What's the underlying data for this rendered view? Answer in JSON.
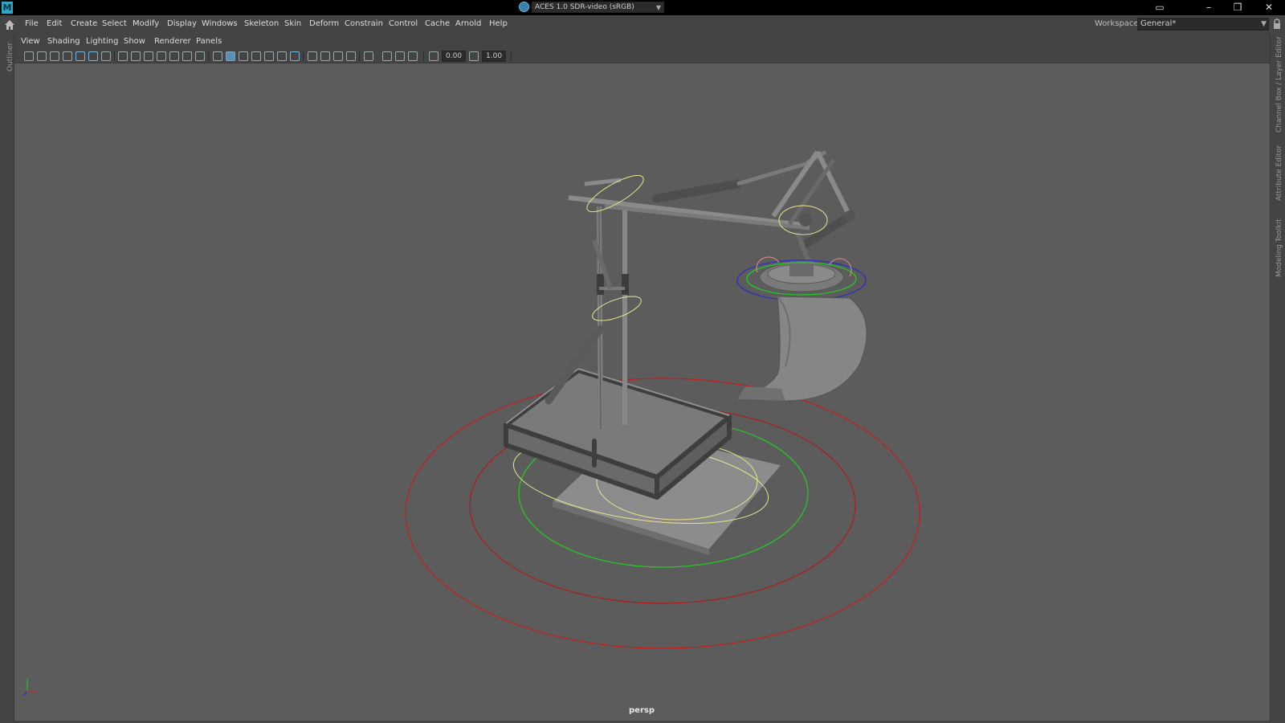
{
  "app": {
    "logo_letter": "M"
  },
  "menubar": {
    "items": [
      "File",
      "Edit",
      "Create",
      "Select",
      "Modify",
      "Display",
      "Windows",
      "Skeleton",
      "Skin",
      "Deform",
      "Constrain",
      "Control",
      "Cache",
      "Arnold",
      "Help"
    ],
    "workspace_label": "Workspace:",
    "workspace_value": "General*"
  },
  "side_tabs": {
    "left": "Outliner",
    "right": [
      "Channel Box / Layer Editor",
      "Attribute Editor",
      "Modeling Toolkit"
    ]
  },
  "panel": {
    "menus": [
      "View",
      "Shading",
      "Lighting",
      "Show",
      "Renderer",
      "Panels"
    ],
    "exposure_value": "0.00",
    "gamma_value": "1.00",
    "color_space": "ACES 1.0 SDR-video (sRGB)"
  },
  "viewport": {
    "camera": "persp",
    "colors": {
      "background": "#5c5c5c",
      "mesh": "#8a8a8a",
      "control_yellow": "#e8e88a",
      "control_green": "#22cc22",
      "control_red": "#cc2222",
      "control_blue": "#2222cc"
    }
  }
}
